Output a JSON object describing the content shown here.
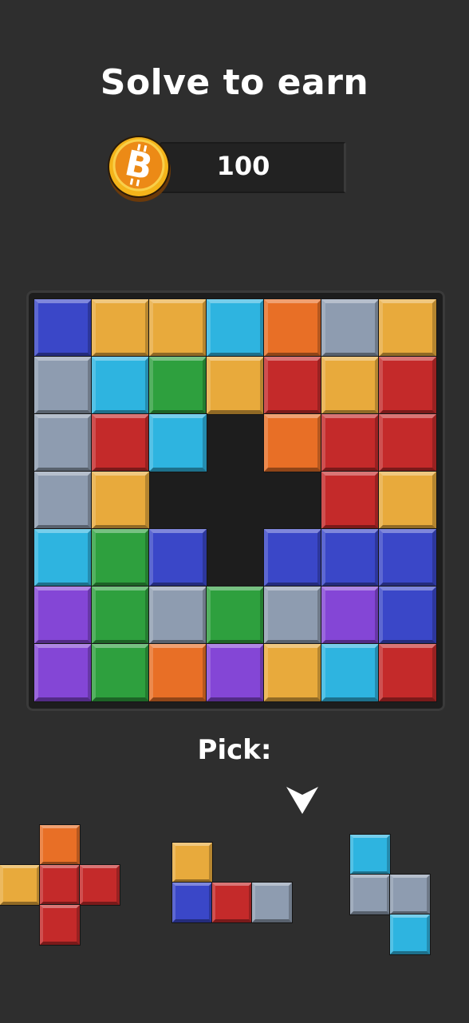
{
  "header": {
    "title": "Solve to earn"
  },
  "coins": {
    "value": "100",
    "icon": "bitcoin-icon"
  },
  "colors": {
    "background": "#2e2e2e",
    "blue": "#3a47c8",
    "yellow": "#e8aa3c",
    "cyan": "#2eb4e0",
    "orange": "#e86f26",
    "gray": "#8e9cb0",
    "red": "#c42a2a",
    "green": "#2ea03e",
    "purple": "#8446d6"
  },
  "board": {
    "rows": 7,
    "cols": 7,
    "cells": [
      [
        "blue",
        "yellow",
        "yellow",
        "cyan",
        "orange",
        "gray",
        "yellow"
      ],
      [
        "gray",
        "cyan",
        "green",
        "yellow",
        "red",
        "yellow",
        "red"
      ],
      [
        "gray",
        "red",
        "cyan",
        null,
        "orange",
        "red",
        "red"
      ],
      [
        "gray",
        "yellow",
        null,
        null,
        null,
        "red",
        "yellow"
      ],
      [
        "cyan",
        "green",
        "blue",
        null,
        "blue",
        "blue",
        "blue"
      ],
      [
        "purple",
        "green",
        "gray",
        "green",
        "gray",
        "purple",
        "blue"
      ],
      [
        "purple",
        "green",
        "orange",
        "purple",
        "yellow",
        "cyan",
        "red"
      ]
    ]
  },
  "pick": {
    "label": "Pick:",
    "arrow_icon": "down-arrow-icon",
    "selected_piece": 2
  },
  "pieces": [
    {
      "cells": [
        [
          1,
          0,
          "orange"
        ],
        [
          0,
          1,
          "yellow"
        ],
        [
          1,
          1,
          "red"
        ],
        [
          2,
          1,
          "red"
        ],
        [
          1,
          2,
          "red"
        ]
      ]
    },
    {
      "cells": [
        [
          0,
          0,
          "yellow"
        ],
        [
          0,
          1,
          "blue"
        ],
        [
          1,
          1,
          "red"
        ],
        [
          2,
          1,
          "gray"
        ]
      ]
    },
    {
      "cells": [
        [
          0,
          0,
          "cyan"
        ],
        [
          0,
          1,
          "gray"
        ],
        [
          1,
          1,
          "gray"
        ],
        [
          1,
          2,
          "cyan"
        ]
      ]
    }
  ]
}
